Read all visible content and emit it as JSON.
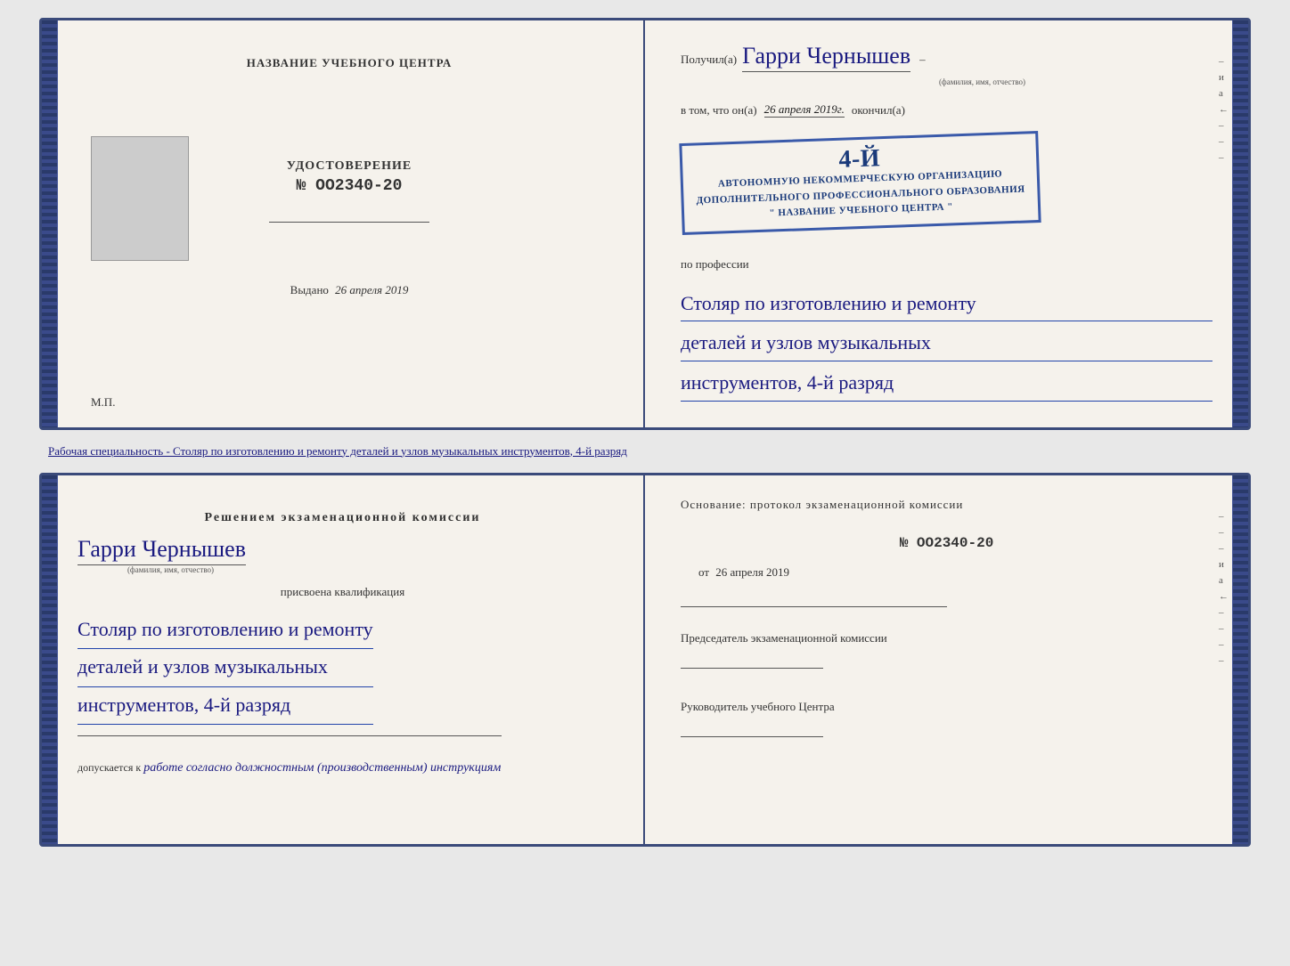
{
  "top_document": {
    "left": {
      "center_title": "НАЗВАНИЕ УЧЕБНОГО ЦЕНТРА",
      "udostoverenie_label": "УДОСТОВЕРЕНИЕ",
      "number": "№ OO2340-20",
      "vydano_label": "Выдано",
      "vydano_date": "26 апреля 2019",
      "mp_label": "М.П."
    },
    "right": {
      "poluchil_label": "Получил(а)",
      "name_handwritten": "Гарри Чернышев",
      "fio_hint": "(фамилия, имя, отчество)",
      "dash": "–",
      "vtom_label": "в том, что он(а)",
      "vtom_date": "26 апреля 2019г.",
      "okonchil_label": "окончил(а)",
      "stamp_line1": "АВТОНОМНУЮ НЕКОММЕРЧЕСКУЮ ОРГАНИЗАЦИЮ",
      "stamp_line2": "ДОПОЛНИТЕЛЬНОГО ПРОФЕССИОНАЛЬНОГО ОБРАЗОВАНИЯ",
      "stamp_line3": "\" НАЗВАНИЕ УЧЕБНОГО ЦЕНТРА \"",
      "stamp_4y": "4-й",
      "po_professii_label": "по профессии",
      "profession_line1": "Столяр по изготовлению и ремонту",
      "profession_line2": "деталей и узлов музыкальных",
      "profession_line3": "инструментов, 4-й разряд"
    }
  },
  "between_label": "Рабочая специальность - Столяр по изготовлению и ремонту деталей и узлов музыкальных инструментов, 4-й разряд",
  "bottom_document": {
    "left": {
      "resheniem_label": "Решением  экзаменационной  комиссии",
      "name_handwritten": "Гарри Чернышев",
      "fio_hint": "(фамилия, имя, отчество)",
      "prisvoena_label": "присвоена квалификация",
      "profession_line1": "Столяр по изготовлению и ремонту",
      "profession_line2": "деталей и узлов музыкальных",
      "profession_line3": "инструментов, 4-й разряд",
      "dopuskaetsya_label": "допускается к",
      "dopuskaetsya_value": "работе согласно должностным (производственным) инструкциям"
    },
    "right": {
      "osnovanie_label": "Основание: протокол экзаменационной комиссии",
      "number": "№  OO2340-20",
      "ot_label": "от",
      "ot_date": "26 апреля 2019",
      "predsedatel_label": "Председатель экзаменационной комиссии",
      "rukovoditel_label": "Руководитель учебного Центра"
    }
  },
  "side_marks": [
    "–",
    "и",
    "а",
    "←",
    "–",
    "–",
    "–",
    "–"
  ]
}
